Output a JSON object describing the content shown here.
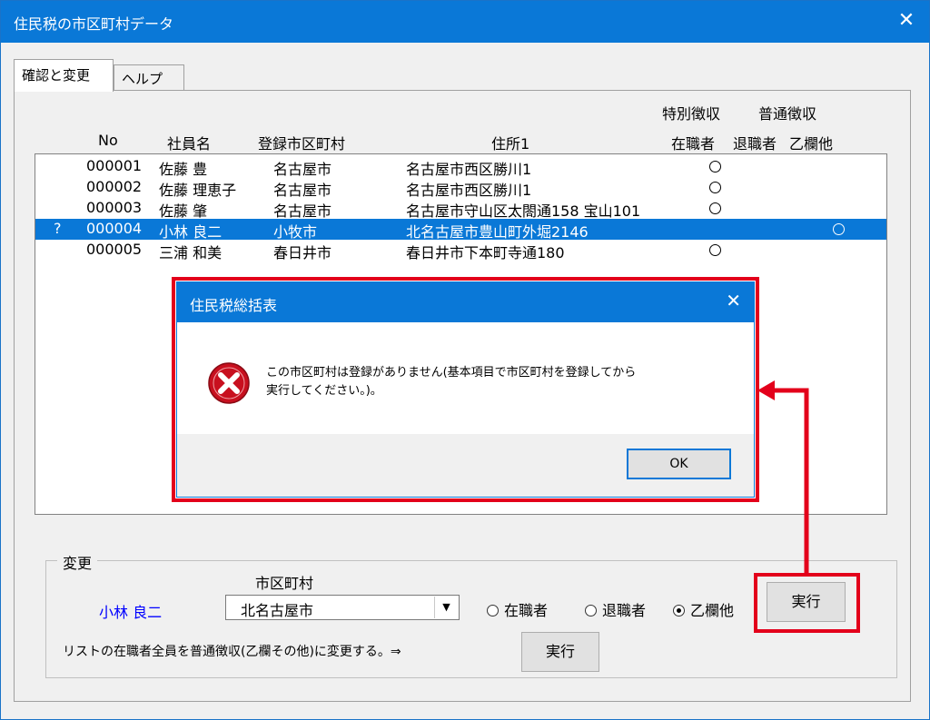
{
  "window": {
    "title": "住民税の市区町村データ",
    "close_glyph": "✕"
  },
  "tabs": [
    {
      "label": "確認と変更"
    },
    {
      "label": "ヘルプ"
    }
  ],
  "headers": {
    "no": "No",
    "employee_name": "社員名",
    "registered_city": "登録市区町村",
    "address1": "住所1",
    "special": "特別徴収",
    "ordinary": "普通徴収",
    "employed": "在職者",
    "retired": "退職者",
    "otsu_other": "乙欄他"
  },
  "rows": [
    {
      "marker": "",
      "no": "000001",
      "name": "佐藤 豊",
      "city": "名古屋市",
      "address": "名古屋市西区勝川1",
      "employed": true,
      "retired": false,
      "other": false,
      "selected": false
    },
    {
      "marker": "",
      "no": "000002",
      "name": "佐藤 理恵子",
      "city": "名古屋市",
      "address": "名古屋市西区勝川1",
      "employed": true,
      "retired": false,
      "other": false,
      "selected": false
    },
    {
      "marker": "",
      "no": "000003",
      "name": "佐藤 肇",
      "city": "名古屋市",
      "address": "名古屋市守山区太閤通158 宝山101",
      "employed": true,
      "retired": false,
      "other": false,
      "selected": false
    },
    {
      "marker": "?",
      "no": "000004",
      "name": "小林 良二",
      "city": "小牧市",
      "address": "北名古屋市豊山町外堀2146",
      "employed": false,
      "retired": false,
      "other": true,
      "selected": true
    },
    {
      "marker": "",
      "no": "000005",
      "name": "三浦 和美",
      "city": "春日井市",
      "address": "春日井市下本町寺通180",
      "employed": true,
      "retired": false,
      "other": false,
      "selected": false
    }
  ],
  "change": {
    "group_label": "変更",
    "city_label": "市区町村",
    "employee": "小林 良二",
    "city_value": "北名古屋市",
    "radio_employed": "在職者",
    "radio_retired": "退職者",
    "radio_other": "乙欄他",
    "execute": "実行",
    "bulk_text": "リストの在職者全員を普通徴収(乙欄その他)に変更する。⇒",
    "bulk_execute": "実行"
  },
  "dialog": {
    "title": "住民税総括表",
    "close_glyph": "✕",
    "message_line1": "この市区町村は登録がありません(基本項目で市区町村を登録してから",
    "message_line2": "実行してください。)。",
    "ok": "OK",
    "icon": "error-icon"
  },
  "colors": {
    "accent": "#0a78d7",
    "highlight": "#e3001b",
    "name_blue": "#0000ff"
  }
}
